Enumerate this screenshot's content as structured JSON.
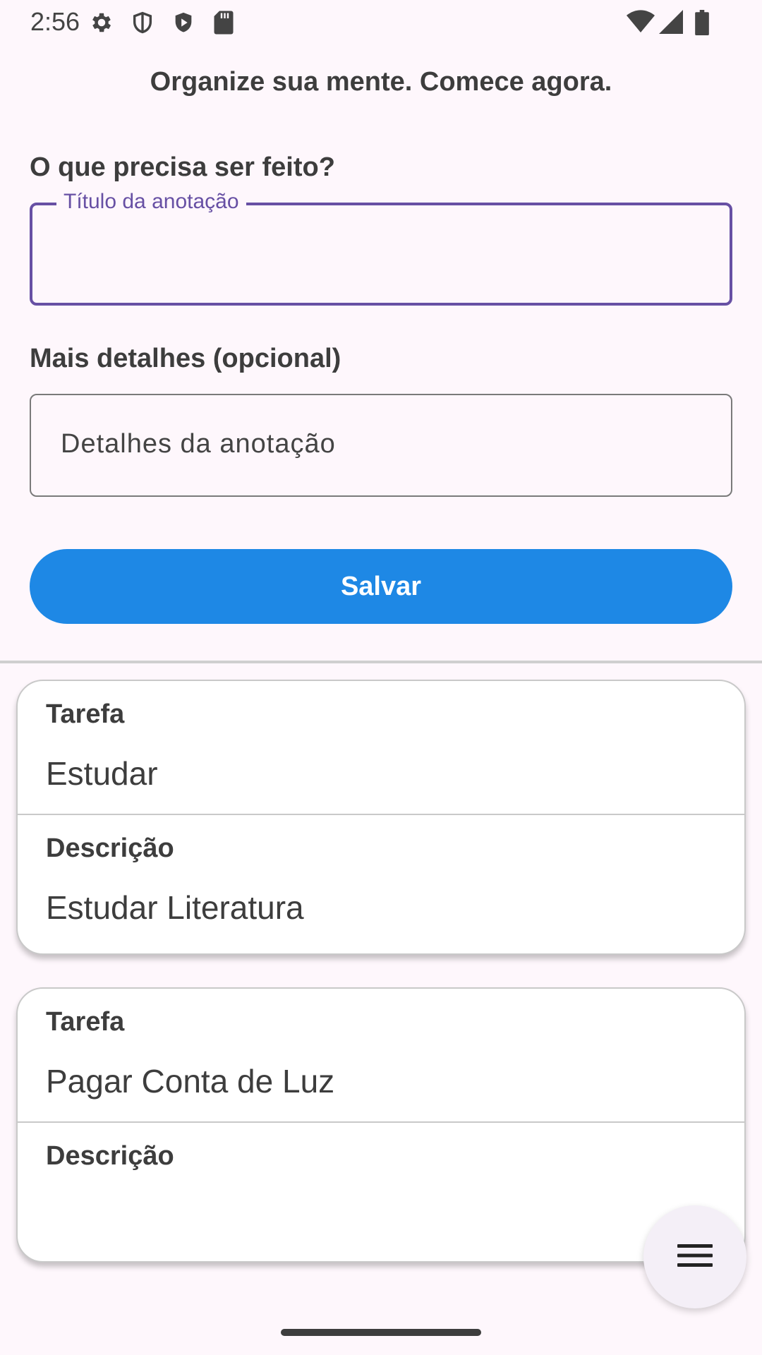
{
  "status_bar": {
    "time": "2:56",
    "icons": [
      "gear-icon",
      "shield-outline-icon",
      "shield-play-icon",
      "sd-card-icon",
      "wifi-icon",
      "signal-icon",
      "battery-icon"
    ]
  },
  "header": {
    "title": "Organize sua mente. Comece agora."
  },
  "form": {
    "title_label": "O que precisa ser feito?",
    "title_input": {
      "floating_label": "Título da anotação",
      "value": ""
    },
    "details_label": "Mais detalhes (opcional)",
    "details_input": {
      "placeholder": "Detalhes da anotação",
      "value": ""
    },
    "save_label": "Salvar"
  },
  "cards": [
    {
      "task_label": "Tarefa",
      "task_value": "Estudar",
      "description_label": "Descrição",
      "description_value": "Estudar Literatura"
    },
    {
      "task_label": "Tarefa",
      "task_value": "Pagar Conta de Luz",
      "description_label": "Descrição",
      "description_value": ""
    }
  ],
  "fab": {
    "icon": "menu-icon"
  },
  "colors": {
    "background": "#FEF7FC",
    "accent_purple": "#6750A4",
    "button_blue": "#1E88E5",
    "card_background": "#FFFFFF"
  }
}
